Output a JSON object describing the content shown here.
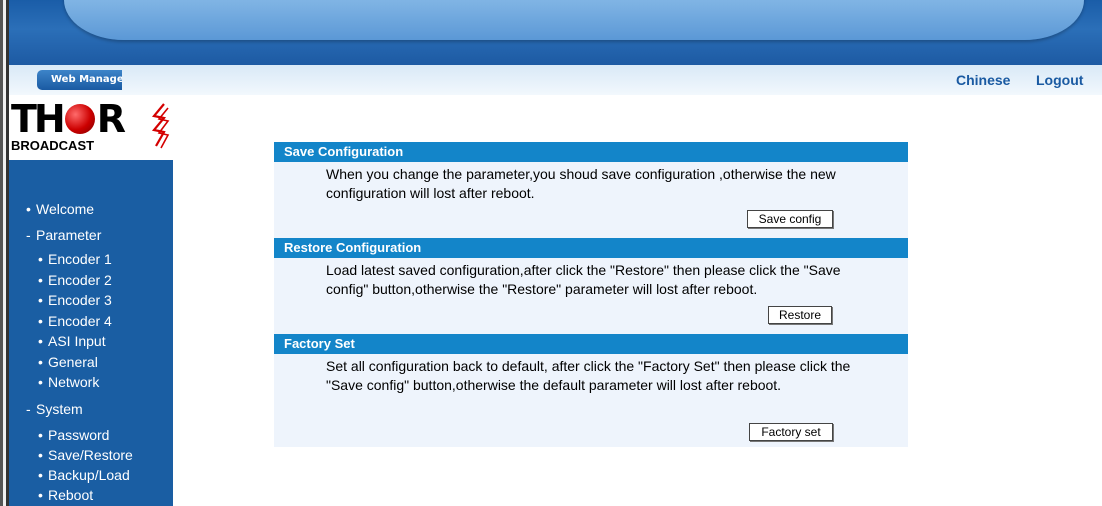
{
  "header": {
    "tab_label": "Web Manage",
    "links": {
      "chinese": "Chinese",
      "logout": "Logout"
    }
  },
  "logo": {
    "main_left": "TH",
    "main_right": "R",
    "sub": "BROADCAST"
  },
  "sidebar": {
    "items": [
      {
        "label": "Welcome",
        "marker": "•"
      },
      {
        "label": "Parameter",
        "marker": "-"
      },
      {
        "label": "Encoder 1",
        "marker": "•"
      },
      {
        "label": "Encoder 2",
        "marker": "•"
      },
      {
        "label": "Encoder 3",
        "marker": "•"
      },
      {
        "label": "Encoder 4",
        "marker": "•"
      },
      {
        "label": "ASI Input",
        "marker": "•"
      },
      {
        "label": "General",
        "marker": "•"
      },
      {
        "label": "Network",
        "marker": "•"
      },
      {
        "label": "System",
        "marker": "-"
      },
      {
        "label": "Password",
        "marker": "•"
      },
      {
        "label": "Save/Restore",
        "marker": "•"
      },
      {
        "label": "Backup/Load",
        "marker": "•"
      },
      {
        "label": "Reboot",
        "marker": "•"
      }
    ]
  },
  "sections": {
    "save": {
      "title": "Save Configuration",
      "text": "When you change the parameter,you shoud save configuration ,otherwise the new configuration will lost after reboot.",
      "button": "Save config"
    },
    "restore": {
      "title": "Restore Configuration",
      "text": "Load latest saved configuration,after click the \"Restore\" then please click the \"Save config\" button,otherwise the \"Restore\" parameter will lost after reboot.",
      "button": "Restore"
    },
    "factory": {
      "title": "Factory Set",
      "text": "Set all configuration back to default, after click the \"Factory Set\" then please click the \"Save config\" button,otherwise the default parameter will lost after reboot.",
      "button": "Factory set"
    }
  },
  "colors": {
    "banner": "#1a5da8",
    "sidebar": "#1a5ea3",
    "section_header": "#1385c9",
    "section_body": "#eef4fc",
    "link": "#1a5aa2"
  }
}
